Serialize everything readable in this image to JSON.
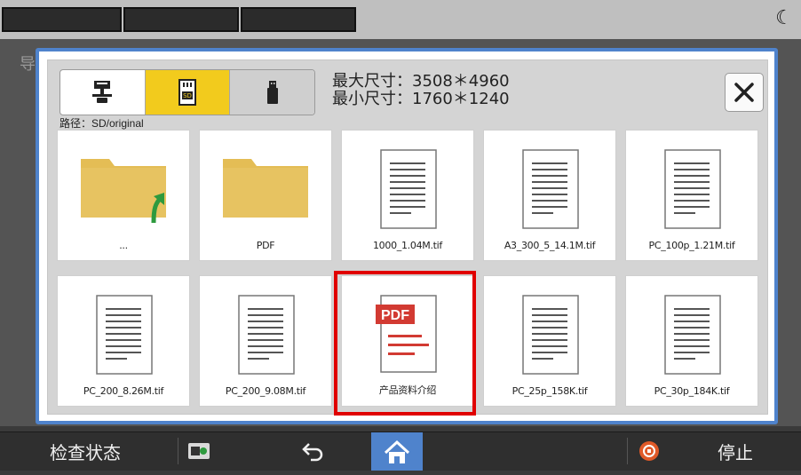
{
  "top": {},
  "background": {
    "char": "导"
  },
  "dialog": {
    "path": "路径：SD/original",
    "max_size": "最大尺寸：3508＊4960",
    "min_size": "最小尺寸：1760＊1240",
    "media_buttons": [
      {
        "name": "pc-share-icon"
      },
      {
        "name": "sd-card-icon",
        "selected": true
      },
      {
        "name": "usb-icon"
      }
    ],
    "files": [
      {
        "label": "...",
        "type": "folder-up"
      },
      {
        "label": "PDF",
        "type": "folder"
      },
      {
        "label": "1000_1.04M.tif",
        "type": "doc"
      },
      {
        "label": "A3_300_5_14.1M.tif",
        "type": "doc"
      },
      {
        "label": "PC_100p_1.21M.tif",
        "type": "doc"
      },
      {
        "label": "PC_200_8.26M.tif",
        "type": "doc"
      },
      {
        "label": "PC_200_9.08M.tif",
        "type": "doc"
      },
      {
        "label": "产品资料介绍",
        "type": "pdf",
        "pdf_badge": "PDF",
        "highlighted": true
      },
      {
        "label": "PC_25p_158K.tif",
        "type": "doc"
      },
      {
        "label": "PC_30p_184K.tif",
        "type": "doc"
      }
    ]
  },
  "bottom": {
    "status_label": "检查状态",
    "stop_label": "停止"
  },
  "colors": {
    "accent_blue": "#4f83cc",
    "sd_yellow": "#f2cb1d",
    "folder": "#e4bd55",
    "highlight": "#e00000",
    "pdf_red": "#d23a32"
  }
}
